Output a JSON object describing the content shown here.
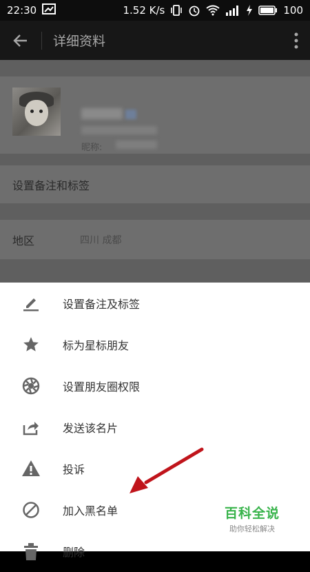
{
  "status_bar": {
    "time": "22:30",
    "speed": "1.52 K/s",
    "battery": "100"
  },
  "header": {
    "title": "详细资料"
  },
  "profile": {
    "nickname_label": "昵称:"
  },
  "details": {
    "remark_row": "设置备注和标签",
    "region_label": "地区",
    "region_value": "四川  成都"
  },
  "menu": {
    "items": [
      {
        "label": "设置备注及标签",
        "icon": "pencil-icon"
      },
      {
        "label": "标为星标朋友",
        "icon": "star-icon"
      },
      {
        "label": "设置朋友圈权限",
        "icon": "aperture-icon"
      },
      {
        "label": "发送该名片",
        "icon": "share-icon"
      },
      {
        "label": "投诉",
        "icon": "warning-icon"
      },
      {
        "label": "加入黑名单",
        "icon": "block-icon"
      },
      {
        "label": "删除",
        "icon": "trash-icon"
      }
    ]
  },
  "watermark": {
    "brand": "百科全说",
    "tagline": "助你轻松解决"
  },
  "colors": {
    "watermark_green": "#37b34a",
    "arrow_red": "#c0141b",
    "icon_gray": "#666666"
  }
}
